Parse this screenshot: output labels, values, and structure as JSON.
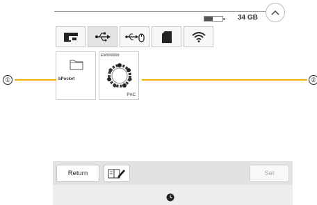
{
  "status": {
    "battery_level": 0.46,
    "storage": "34 GB"
  },
  "tabs": [
    {
      "name": "machine",
      "icon": "sewing-machine-icon",
      "active": false
    },
    {
      "name": "usb",
      "icon": "usb-icon",
      "active": true
    },
    {
      "name": "usb-mouse",
      "icon": "usb-mouse-icon",
      "active": false
    },
    {
      "name": "sd-card",
      "icon": "sd-card-icon",
      "active": false
    },
    {
      "name": "wireless",
      "icon": "wifi-icon",
      "active": false
    }
  ],
  "files": {
    "folder": {
      "label": "bPocket",
      "icon": "folder-icon"
    },
    "design": {
      "id": "EM999999",
      "format": "PHC",
      "icon": "embroidery-wreath-icon"
    }
  },
  "buttons": {
    "return": "Return",
    "set": "Set",
    "edit_icon": "edit-book-icon"
  },
  "callouts": {
    "one": "①",
    "two": "②"
  },
  "colors": {
    "leader_line": "#f0b400",
    "bottom_bar": "#e2e2e2",
    "active_tab": "#e3e3e3"
  }
}
